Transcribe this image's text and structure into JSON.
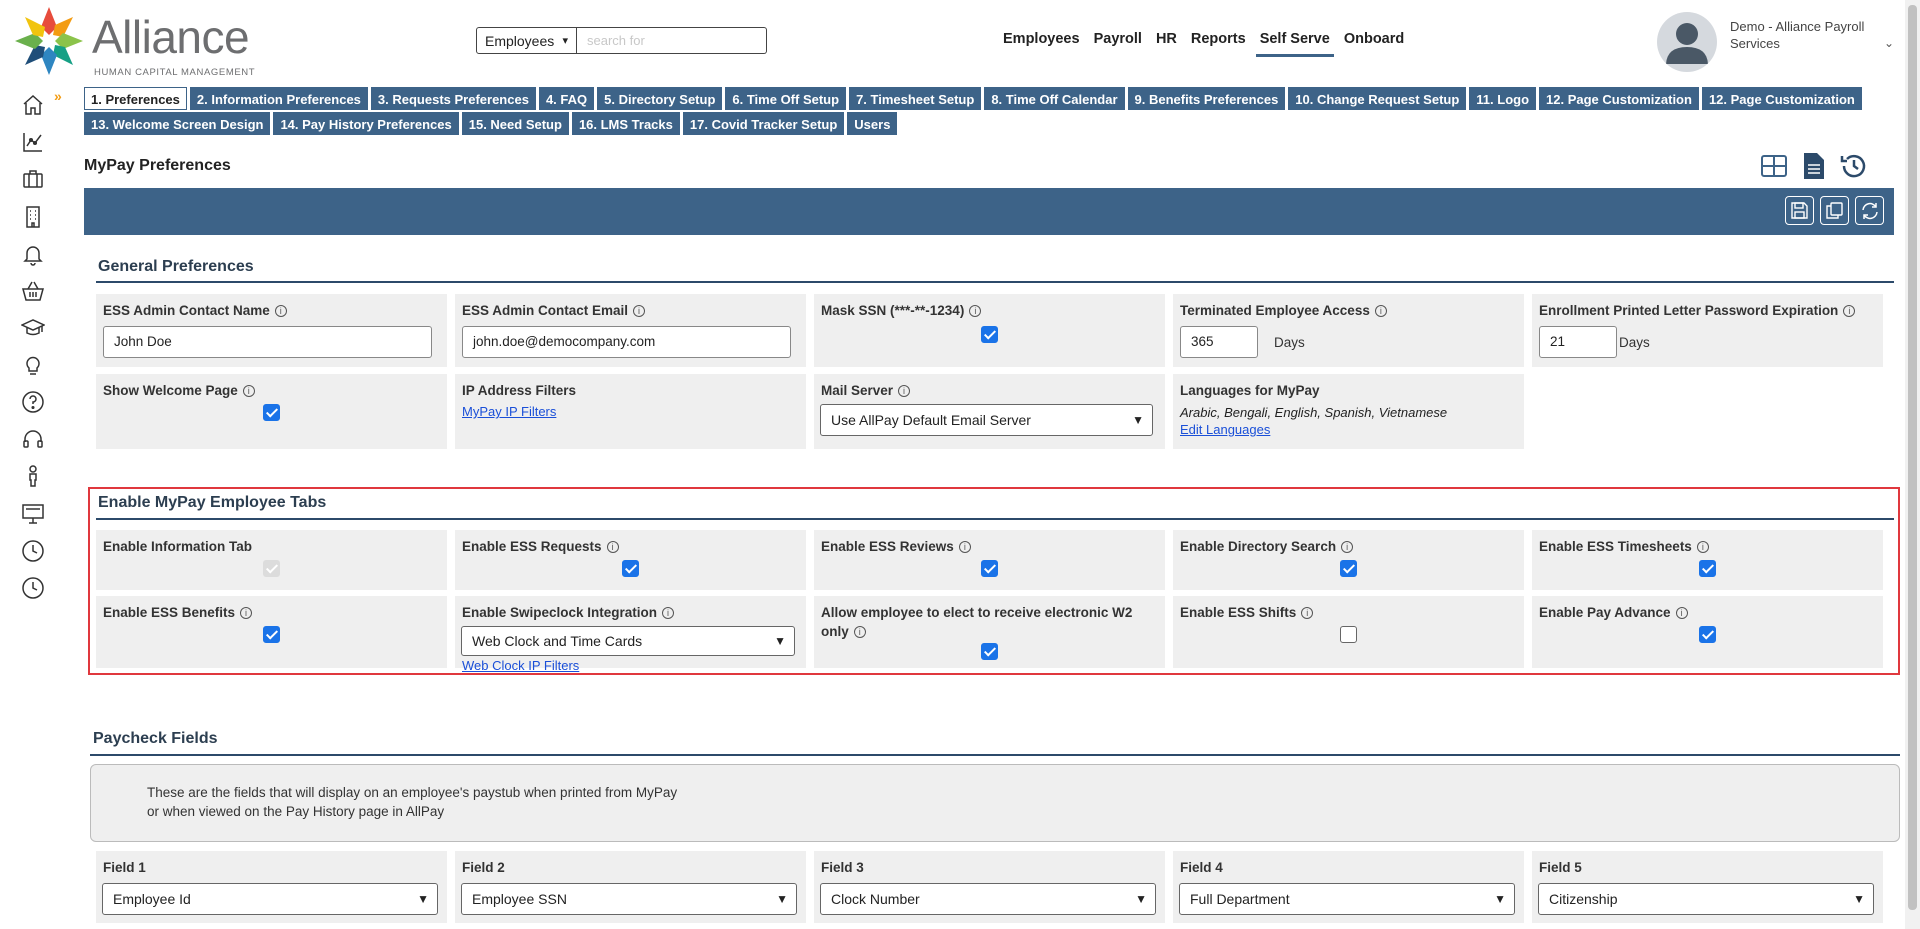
{
  "brand": {
    "name": "Alliance",
    "subtitle": "HUMAN CAPITAL MANAGEMENT",
    "colors": {
      "primary": "#3d6388",
      "highlight": "#e0383e",
      "checkbox": "#1a73e8"
    }
  },
  "search": {
    "scope": "Employees",
    "placeholder": "search for"
  },
  "topnav": [
    "Employees",
    "Payroll",
    "HR",
    "Reports",
    "Self Serve",
    "Onboard"
  ],
  "topnav_active": "Self Serve",
  "user": {
    "name": "Demo - Alliance Payroll Services"
  },
  "sidebar_icons": [
    "home-icon",
    "chart-icon",
    "briefcase-icon",
    "building-icon",
    "bell-icon",
    "basket-icon",
    "graduation-cap-icon",
    "lightbulb-icon",
    "help-icon",
    "headset-icon",
    "person-icon",
    "monitor-icon",
    "clock-icon",
    "clock-icon"
  ],
  "tabs_row1": [
    "1. Preferences",
    "2. Information Preferences",
    "3. Requests Preferences",
    "4. FAQ",
    "5. Directory Setup",
    "6. Time Off Setup",
    "7. Timesheet Setup",
    "8. Time Off Calendar",
    "9. Benefits Preferences",
    "10. Change Request Setup",
    "11. Logo",
    "12. Page Customization",
    "12. Page Customization"
  ],
  "tabs_row2": [
    "13. Welcome Screen Design",
    "14. Pay History Preferences",
    "15. Need Setup",
    "16. LMS Tracks",
    "17. Covid Tracker Setup",
    "Users"
  ],
  "active_tab": "1. Preferences",
  "page_title": "MyPay Preferences",
  "general": {
    "title": "General Preferences",
    "admin_name_label": "ESS Admin Contact Name",
    "admin_name_value": "John Doe",
    "admin_email_label": "ESS Admin Contact Email",
    "admin_email_value": "john.doe@democompany.com",
    "mask_ssn_label": "Mask SSN (***-**-1234)",
    "mask_ssn_checked": true,
    "terminated_label": "Terminated Employee Access",
    "terminated_value": "365",
    "terminated_unit": "Days",
    "enrollment_label": "Enrollment Printed Letter Password Expiration",
    "enrollment_value": "21",
    "enrollment_unit": "Days",
    "welcome_label": "Show Welcome Page",
    "welcome_checked": true,
    "ip_label": "IP Address Filters",
    "ip_link": "MyPay IP Filters",
    "mail_label": "Mail Server",
    "mail_value": "Use AllPay Default Email Server",
    "languages_label": "Languages for MyPay",
    "languages_value": "Arabic, Bengali, English, Spanish, Vietnamese",
    "languages_link": "Edit Languages"
  },
  "tabs_section": {
    "title": "Enable MyPay Employee Tabs",
    "info_tab_label": "Enable Information Tab",
    "requests_label": "Enable ESS Requests",
    "reviews_label": "Enable ESS Reviews",
    "directory_label": "Enable Directory Search",
    "timesheets_label": "Enable ESS Timesheets",
    "benefits_label": "Enable ESS Benefits",
    "swipeclock_label": "Enable Swipeclock Integration",
    "swipeclock_value": "Web Clock and Time Cards",
    "swipeclock_link": "Web Clock IP Filters",
    "w2_label": "Allow employee to elect to receive electronic W2 only",
    "shifts_label": "Enable ESS Shifts",
    "pay_advance_label": "Enable Pay Advance"
  },
  "paycheck": {
    "title": "Paycheck Fields",
    "note_line1": "These are the fields that will display on an employee's paystub when printed from MyPay",
    "note_line2": "or when viewed on the Pay History page in AllPay",
    "fields": [
      {
        "label": "Field 1",
        "value": "Employee Id"
      },
      {
        "label": "Field 2",
        "value": "Employee SSN"
      },
      {
        "label": "Field 3",
        "value": "Clock Number"
      },
      {
        "label": "Field 4",
        "value": "Full Department"
      },
      {
        "label": "Field 5",
        "value": "Citizenship"
      }
    ]
  }
}
